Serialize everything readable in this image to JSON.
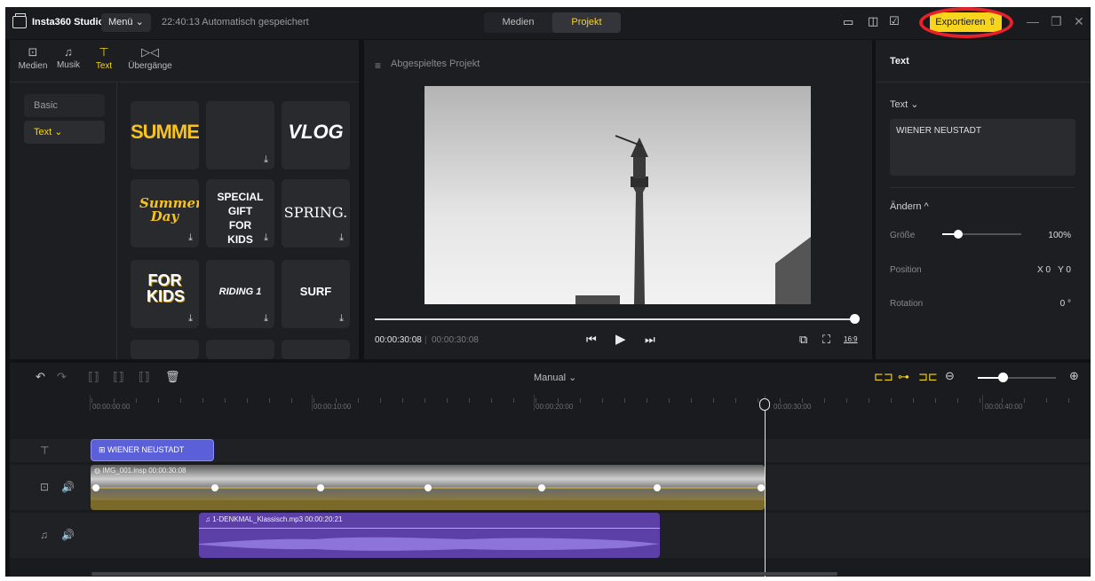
{
  "titlebar": {
    "app_name": "Insta360 Studio",
    "menu_label": "Menü ⌄",
    "autosave_text": "22:40:13 Automatisch gespeichert",
    "tabs": [
      {
        "label": "Medien"
      },
      {
        "label": "Projekt"
      }
    ],
    "active_tab": "Projekt",
    "export_label": "Exportieren ⇧"
  },
  "left_panel": {
    "tabs": [
      {
        "label": "Medien",
        "icon": "media-icon"
      },
      {
        "label": "Musik",
        "icon": "music-icon"
      },
      {
        "label": "Text",
        "icon": "text-icon"
      },
      {
        "label": "Übergänge",
        "icon": "transitions-icon"
      }
    ],
    "active_tab": "Text",
    "categories": [
      {
        "label": "Basic"
      },
      {
        "label": "Text ⌄"
      }
    ],
    "active_category": "Text",
    "templates": [
      "SUMMER",
      "",
      "VLOG",
      "Summer Day",
      "SPECIAL GIFT FOR KIDS",
      "SPRING.",
      "FOR KIDS",
      "RIDING 1",
      "SURF"
    ]
  },
  "preview": {
    "title": "Abgespieltes Projekt",
    "time_current": "00:00:30:08",
    "time_total": "00:00:30:08",
    "aspect_ratio": "16:9",
    "progress": 1.0
  },
  "right_panel": {
    "title": "Text",
    "text_section": "Text ⌄",
    "text_value": "WIENER NEUSTADT",
    "adjust_section": "Ändern ^",
    "size_label": "Größe",
    "size_value": "100%",
    "size_fraction": 0.19,
    "position_label": "Position",
    "position_value": "X 0   Y 0",
    "rotation_label": "Rotation",
    "rotation_value": "0 °"
  },
  "timeline": {
    "mode_label": "Manual ⌄",
    "ruler_labels": [
      "00:00:00:00",
      "00:00:10:00",
      "00:00:20:00",
      "00:00:30:00",
      "00:00:40:00"
    ],
    "text_clip": "WIENER NEUSTADT",
    "video_clip": "IMG_001.insp  00:00:30:08",
    "audio_clip": "1-DENKMAL_Klassisch.mp3  00:00:20:21",
    "zoom_fraction": 0.3
  },
  "colors": {
    "accent": "#f7d51d",
    "background": "#111214",
    "panel": "#1d1e22",
    "text_clip": "#5b5fd8",
    "audio_clip": "#5d3fa8",
    "highlight": "#e8202a"
  }
}
